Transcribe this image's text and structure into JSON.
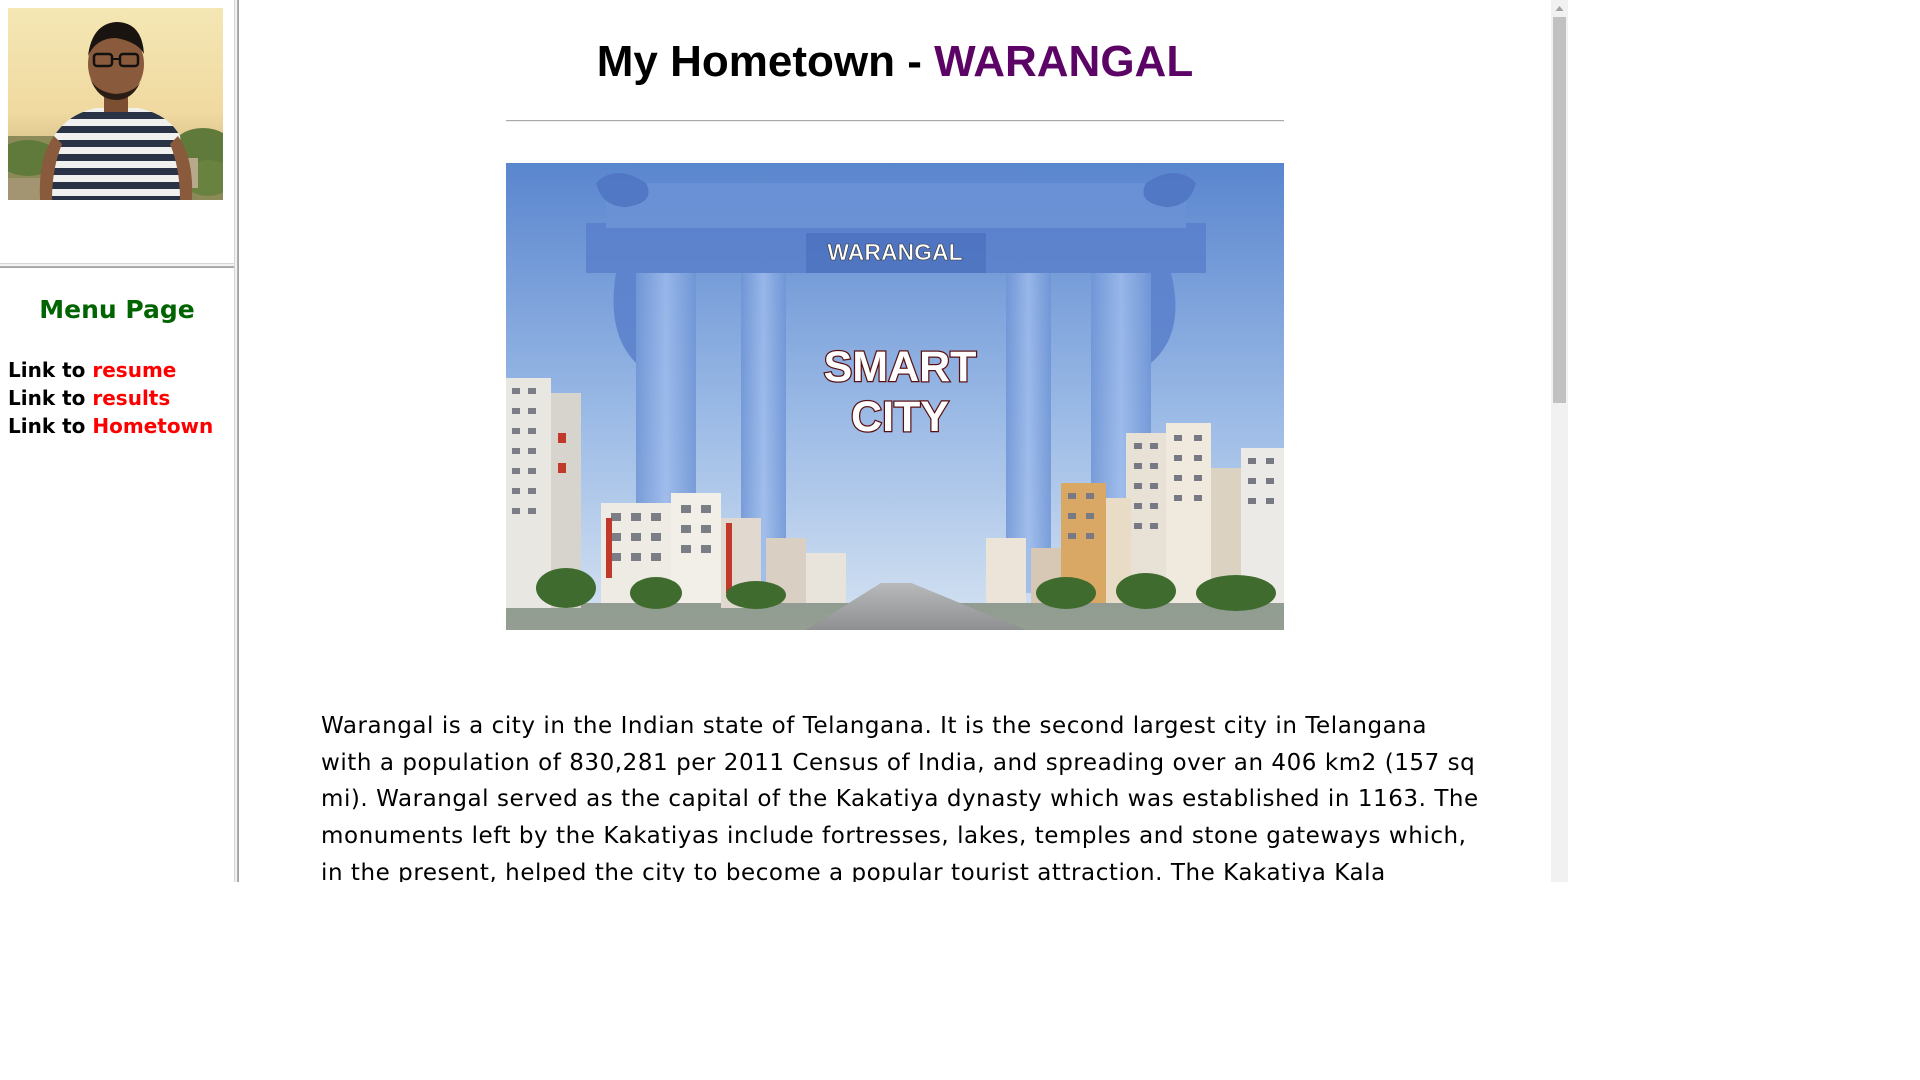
{
  "sidebar": {
    "menu_title": "Menu Page",
    "links": [
      {
        "prefix": "Link to ",
        "label": "resume"
      },
      {
        "prefix": "Link to ",
        "label": "results"
      },
      {
        "prefix": "Link to ",
        "label": "Hometown"
      }
    ]
  },
  "main": {
    "heading_prefix": "My Hometown - ",
    "heading_accent": "WARANGAL",
    "hero": {
      "top_label": "WARANGAL",
      "line1": "SMART",
      "line2": "CITY"
    },
    "description": "Warangal is a city in the Indian state of Telangana. It is the second largest city in Telangana with a population of 830,281 per 2011 Census of India, and spreading over an 406 km2 (157 sq mi). Warangal served as the capital of the Kakatiya dynasty which was established in 1163. The monuments left by the Kakatiyas include fortresses, lakes, temples and stone gateways which, in the present, helped the city to become a popular tourist attraction. The Kakatiya Kala"
  },
  "colors": {
    "menu_title": "#006400",
    "link": "#ff0000",
    "heading_accent": "#5c0466"
  },
  "icons": {
    "scroll_up": "triangle-up-icon"
  }
}
